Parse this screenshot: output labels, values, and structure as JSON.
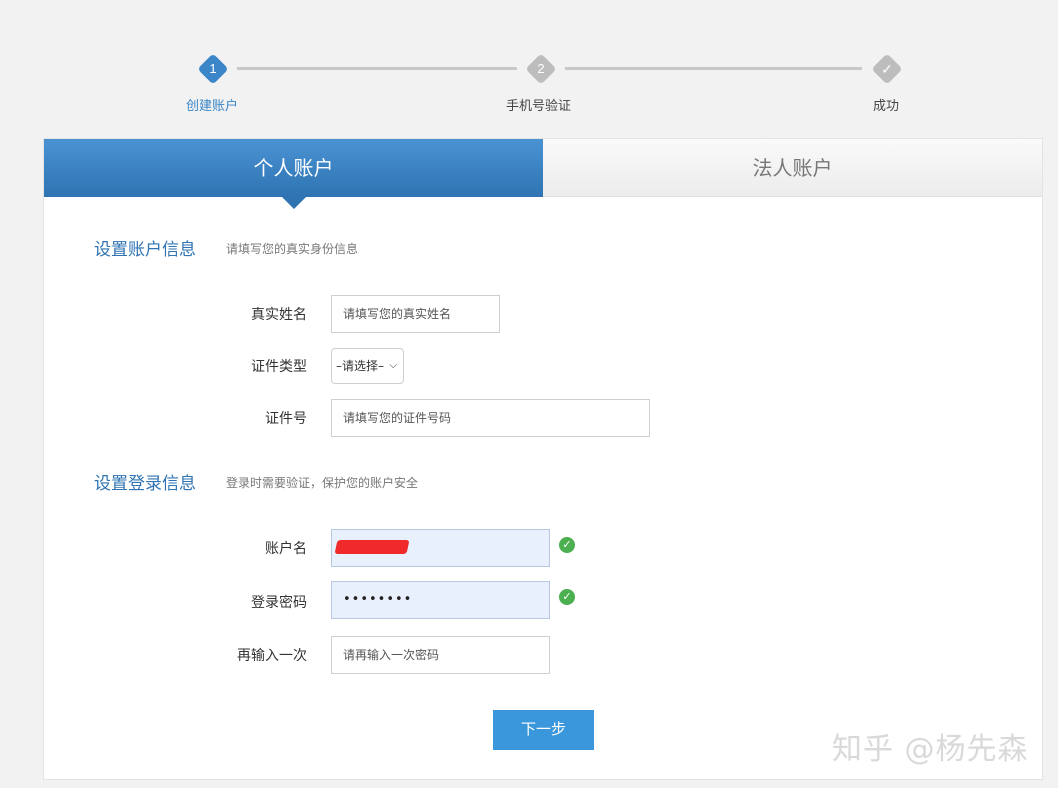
{
  "stepper": {
    "steps": [
      {
        "num": "1",
        "label": "创建账户"
      },
      {
        "num": "2",
        "label": "手机号验证"
      },
      {
        "num": "✓",
        "label": "成功"
      }
    ]
  },
  "tabs": [
    {
      "label": "个人账户"
    },
    {
      "label": "法人账户"
    }
  ],
  "account_info": {
    "title": "设置账户信息",
    "hint": "请填写您的真实身份信息",
    "real_name": {
      "label": "真实姓名",
      "placeholder": "请填写您的真实姓名"
    },
    "id_type": {
      "label": "证件类型",
      "value": "–请选择–"
    },
    "id_number": {
      "label": "证件号",
      "placeholder": "请填写您的证件号码"
    }
  },
  "login_info": {
    "title": "设置登录信息",
    "hint": "登录时需要验证，保护您的账户安全",
    "username": {
      "label": "账户名"
    },
    "password": {
      "label": "登录密码",
      "value": "••••••••"
    },
    "confirm": {
      "label": "再输入一次",
      "placeholder": "请再输入一次密码"
    }
  },
  "actions": {
    "next": "下一步"
  },
  "watermark": "知乎 @杨先森",
  "colors": {
    "accent": "#2f73b2",
    "button": "#3a97db",
    "success": "#4caf50"
  }
}
